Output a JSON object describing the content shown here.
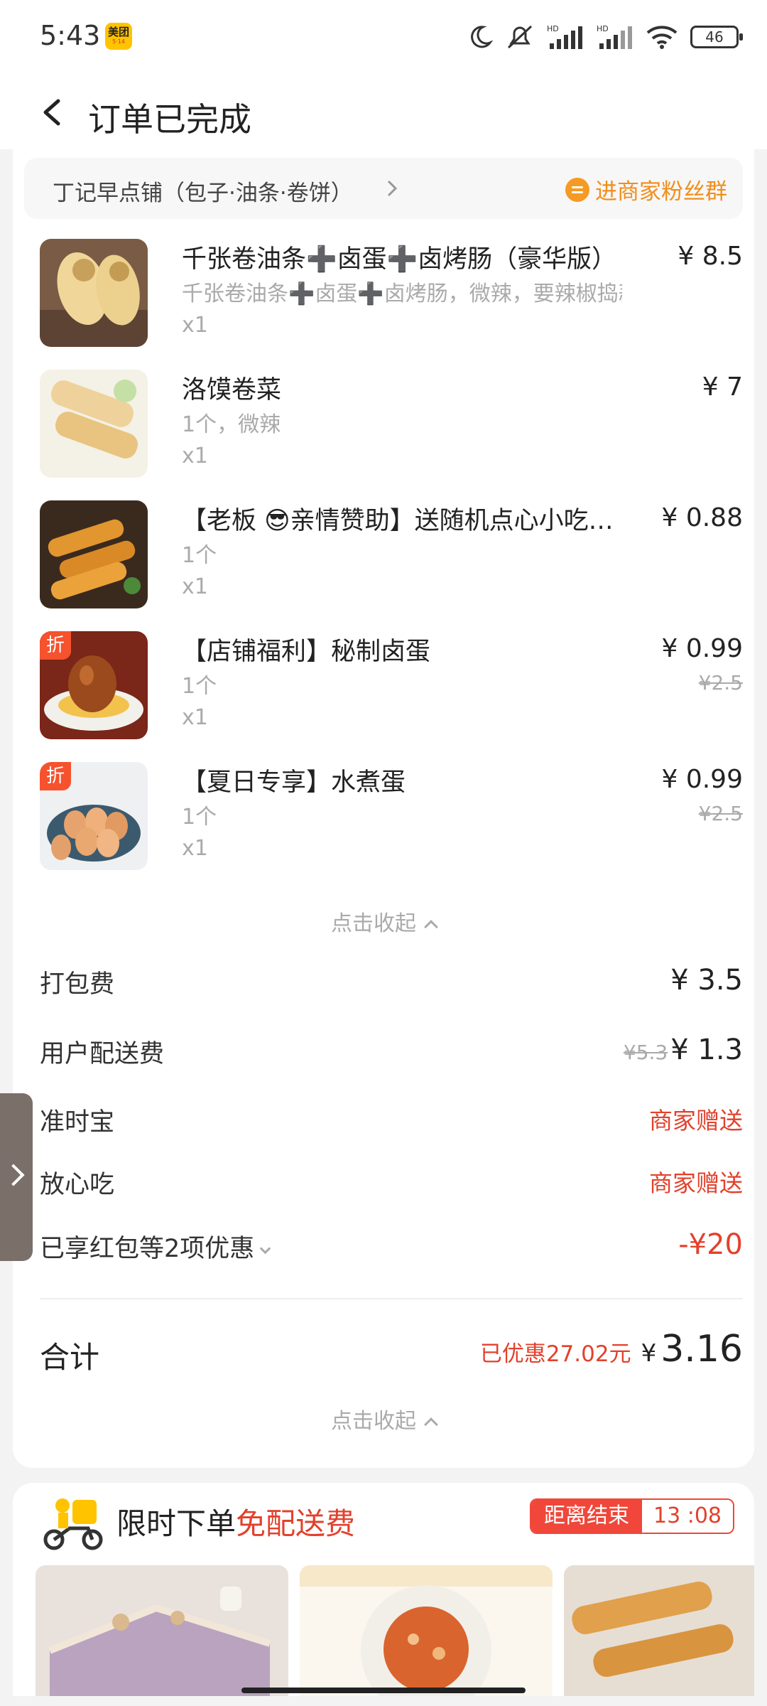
{
  "status": {
    "time": "5:43",
    "app_badge": "美团",
    "app_badge_sub": "5·14",
    "battery": "46"
  },
  "header": {
    "title": "订单已完成"
  },
  "shop": {
    "name": "丁记早点铺（包子·油条·卷饼）",
    "fans_label": "进商家粉丝群"
  },
  "items": [
    {
      "name": "千张卷油条➕卤蛋➕卤烤肠（豪华版）",
      "spec": "千张卷油条➕卤蛋➕卤烤肠，微辣，要辣椒捣蒜",
      "qty": "x1",
      "price": "¥ 8.5",
      "orig": "",
      "tag": ""
    },
    {
      "name": "洛馍卷菜",
      "spec": "1个，微辣",
      "qty": "x1",
      "price": "¥ 7",
      "orig": "",
      "tag": ""
    },
    {
      "name": "【老板 😎亲情赞助】送随机点心小吃…",
      "spec": "1个",
      "qty": "x1",
      "price": "¥ 0.88",
      "orig": "",
      "tag": ""
    },
    {
      "name": "【店铺福利】秘制卤蛋",
      "spec": "1个",
      "qty": "x1",
      "price": "¥ 0.99",
      "orig": "¥2.5",
      "tag": "折"
    },
    {
      "name": "【夏日专享】水煮蛋",
      "spec": "1个",
      "qty": "x1",
      "price": "¥ 0.99",
      "orig": "¥2.5",
      "tag": "折"
    }
  ],
  "collapse_label": "点击收起",
  "fees": {
    "packing": {
      "label": "打包费",
      "value": "¥ 3.5"
    },
    "delivery": {
      "label": "用户配送费",
      "orig": "¥5.3",
      "value": "¥ 1.3"
    },
    "ontime": {
      "label": "准时宝",
      "value": "商家赠送"
    },
    "safe": {
      "label": "放心吃",
      "value": "商家赠送"
    },
    "discount": {
      "label": "已享红包等2项优惠",
      "value": "-¥20"
    }
  },
  "total": {
    "label": "合计",
    "saved": "已优惠27.02元",
    "currency": "¥",
    "value": "3.16"
  },
  "promo": {
    "title_a": "限时下单",
    "title_b": "免配送费",
    "countdown_label": "距离结束",
    "countdown_time": "13 :08"
  },
  "colors": {
    "accent_red": "#e2412c",
    "fans_orange": "#f08e1b",
    "badge_yellow": "#ffc300"
  },
  "icons": [
    "back-arrow-icon",
    "moon-icon",
    "mute-icon",
    "signal-icon",
    "wifi-icon",
    "battery-icon",
    "chevron-right-icon",
    "group-chat-icon",
    "chevron-up-icon",
    "chevron-down-icon",
    "delivery-scooter-icon"
  ]
}
